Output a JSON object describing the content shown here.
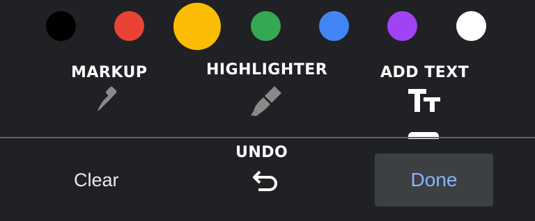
{
  "palette": {
    "colors": [
      {
        "name": "black",
        "hex": "#000000",
        "selected": false
      },
      {
        "name": "red",
        "hex": "#EA4335",
        "selected": false
      },
      {
        "name": "yellow",
        "hex": "#FBBC04",
        "selected": true
      },
      {
        "name": "green",
        "hex": "#34A853",
        "selected": false
      },
      {
        "name": "blue",
        "hex": "#4285F4",
        "selected": false
      },
      {
        "name": "purple",
        "hex": "#A142F4",
        "selected": false
      },
      {
        "name": "white",
        "hex": "#FFFFFF",
        "selected": false
      }
    ]
  },
  "tools": {
    "markup": {
      "label": "MARKUP",
      "icon": "pen-icon"
    },
    "highlighter": {
      "label": "HIGHLIGHTER",
      "icon": "highlighter-icon"
    },
    "add_text": {
      "label": "ADD TEXT",
      "icon": "text-format-icon"
    }
  },
  "bottom": {
    "clear_label": "Clear",
    "undo_label": "UNDO",
    "undo_icon": "undo-icon",
    "done_label": "Done"
  },
  "colors": {
    "background": "#202124",
    "done_bg": "#3C4043",
    "done_text": "#8AB4F8",
    "divider": "#5F6368"
  }
}
